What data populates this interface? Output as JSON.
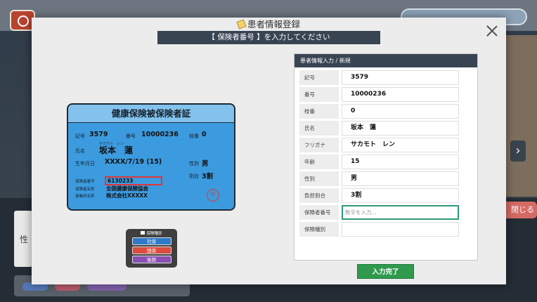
{
  "modal": {
    "title": "患者情報登録",
    "instruction": "【 保険者番号 】を入力してください"
  },
  "card": {
    "title": "健康保険被保険者証",
    "kigou_label": "記号",
    "kigou_value": "3579",
    "bangou_label": "番号",
    "bangou_value": "10000236",
    "edaban_label": "枝番",
    "edaban_value": "0",
    "name_label": "氏名",
    "name_kana": "サカモト　レン",
    "name_value": "坂本　蓮",
    "birth_label": "生年月日",
    "birth_value": "XXXX/7/19 (15)",
    "sex_label": "性別",
    "sex_value": "男",
    "ratio_label": "割合",
    "ratio_value": "3割",
    "insurer_no_label": "保険者番号",
    "insurer_no_value": "6130233",
    "insurer_name_label": "保険者名称",
    "insurer_name_value": "全国健康保険協会",
    "office_label": "事業所名称",
    "office_value": "株式会社XXXXX",
    "seal": "印"
  },
  "insurance_type": {
    "label": "保険種別",
    "options": [
      "社保",
      "国保",
      "後期"
    ]
  },
  "form": {
    "header": "患者情報入力 / 新規",
    "rows": [
      {
        "label": "記号",
        "value": "3579"
      },
      {
        "label": "番号",
        "value": "10000236"
      },
      {
        "label": "枝番",
        "value": "0"
      },
      {
        "label": "氏名",
        "value": "坂本　蓮"
      },
      {
        "label": "フリガナ",
        "value": "サカモト　レン"
      },
      {
        "label": "年齢",
        "value": "15"
      },
      {
        "label": "性別",
        "value": "男"
      },
      {
        "label": "負担割合",
        "value": "3割"
      },
      {
        "label": "保険者番号",
        "value": ""
      },
      {
        "label": "保険種別",
        "value": ""
      }
    ],
    "insurer_placeholder": "数字を入力...",
    "submit_label": "入力完了"
  },
  "background": {
    "close_label": "閉じる",
    "side_label": "性"
  },
  "colors": {
    "header_dark": "#394453",
    "card_blue": "#3c9bdf",
    "submit_green": "#2f9a4e",
    "active_border": "#2f9a7a",
    "highlight_red": "#e03535"
  }
}
